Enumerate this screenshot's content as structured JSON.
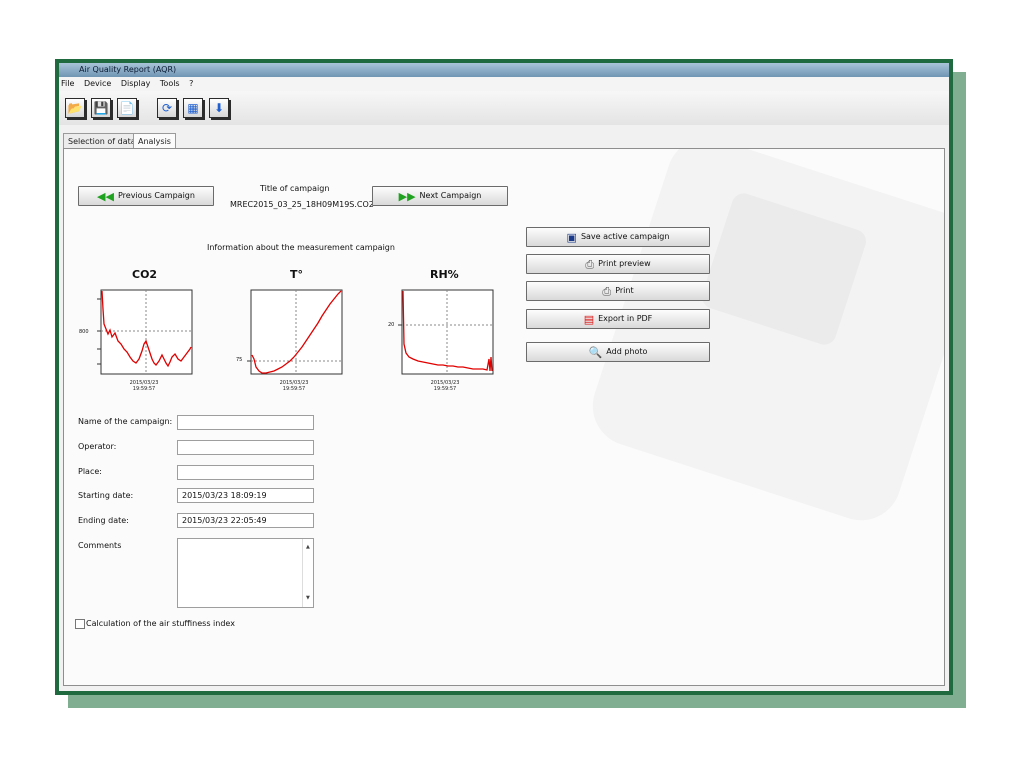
{
  "window": {
    "title": "Air Quality Report (AQR)"
  },
  "menu": [
    "File",
    "Device",
    "Display",
    "Tools",
    "?"
  ],
  "toolbar": [
    {
      "icon": "open-folder-icon",
      "glyph": "📂"
    },
    {
      "icon": "save-icon",
      "glyph": "💾"
    },
    {
      "icon": "document-icon",
      "glyph": "📄"
    },
    {
      "icon": "refresh-icon",
      "glyph": "⟳"
    },
    {
      "icon": "calendar-icon",
      "glyph": "▦"
    },
    {
      "icon": "download-icon",
      "glyph": "⬇"
    }
  ],
  "tabs": {
    "selection": "Selection of data",
    "analysis": "Analysis"
  },
  "campaign": {
    "prev_label": "Previous Campaign",
    "next_label": "Next Campaign",
    "title_caption": "Title of campaign",
    "title_value": "MREC2015_03_25_18H09M19S.CO2",
    "info": "Information about the measurement campaign"
  },
  "actions": {
    "save": "Save active campaign",
    "preview": "Print preview",
    "print": "Print",
    "pdf": "Export in PDF",
    "photo": "Add photo"
  },
  "charts": {
    "co2": {
      "title": "CO2",
      "ytick": "800",
      "xtick_date": "2015/03/23",
      "xtick_time": "19:59:57"
    },
    "temp": {
      "title": "T°",
      "ytick": "75",
      "xtick_date": "2015/03/23",
      "xtick_time": "19:59:57"
    },
    "rh": {
      "title": "RH%",
      "ytick": "20",
      "xtick_date": "2015/03/23",
      "xtick_time": "19:59:57"
    }
  },
  "form": {
    "name_label": "Name of the campaign:",
    "name_value": "",
    "operator_label": "Operator:",
    "operator_value": "",
    "place_label": "Place:",
    "place_value": "",
    "start_label": "Starting date:",
    "start_value": "2015/03/23 18:09:19",
    "end_label": "Ending date:",
    "end_value": "2015/03/23 22:05:49",
    "comments_label": "Comments",
    "comments_value": ""
  },
  "checkbox": {
    "label": "Calculation of the air stuffiness index",
    "checked": false
  }
}
